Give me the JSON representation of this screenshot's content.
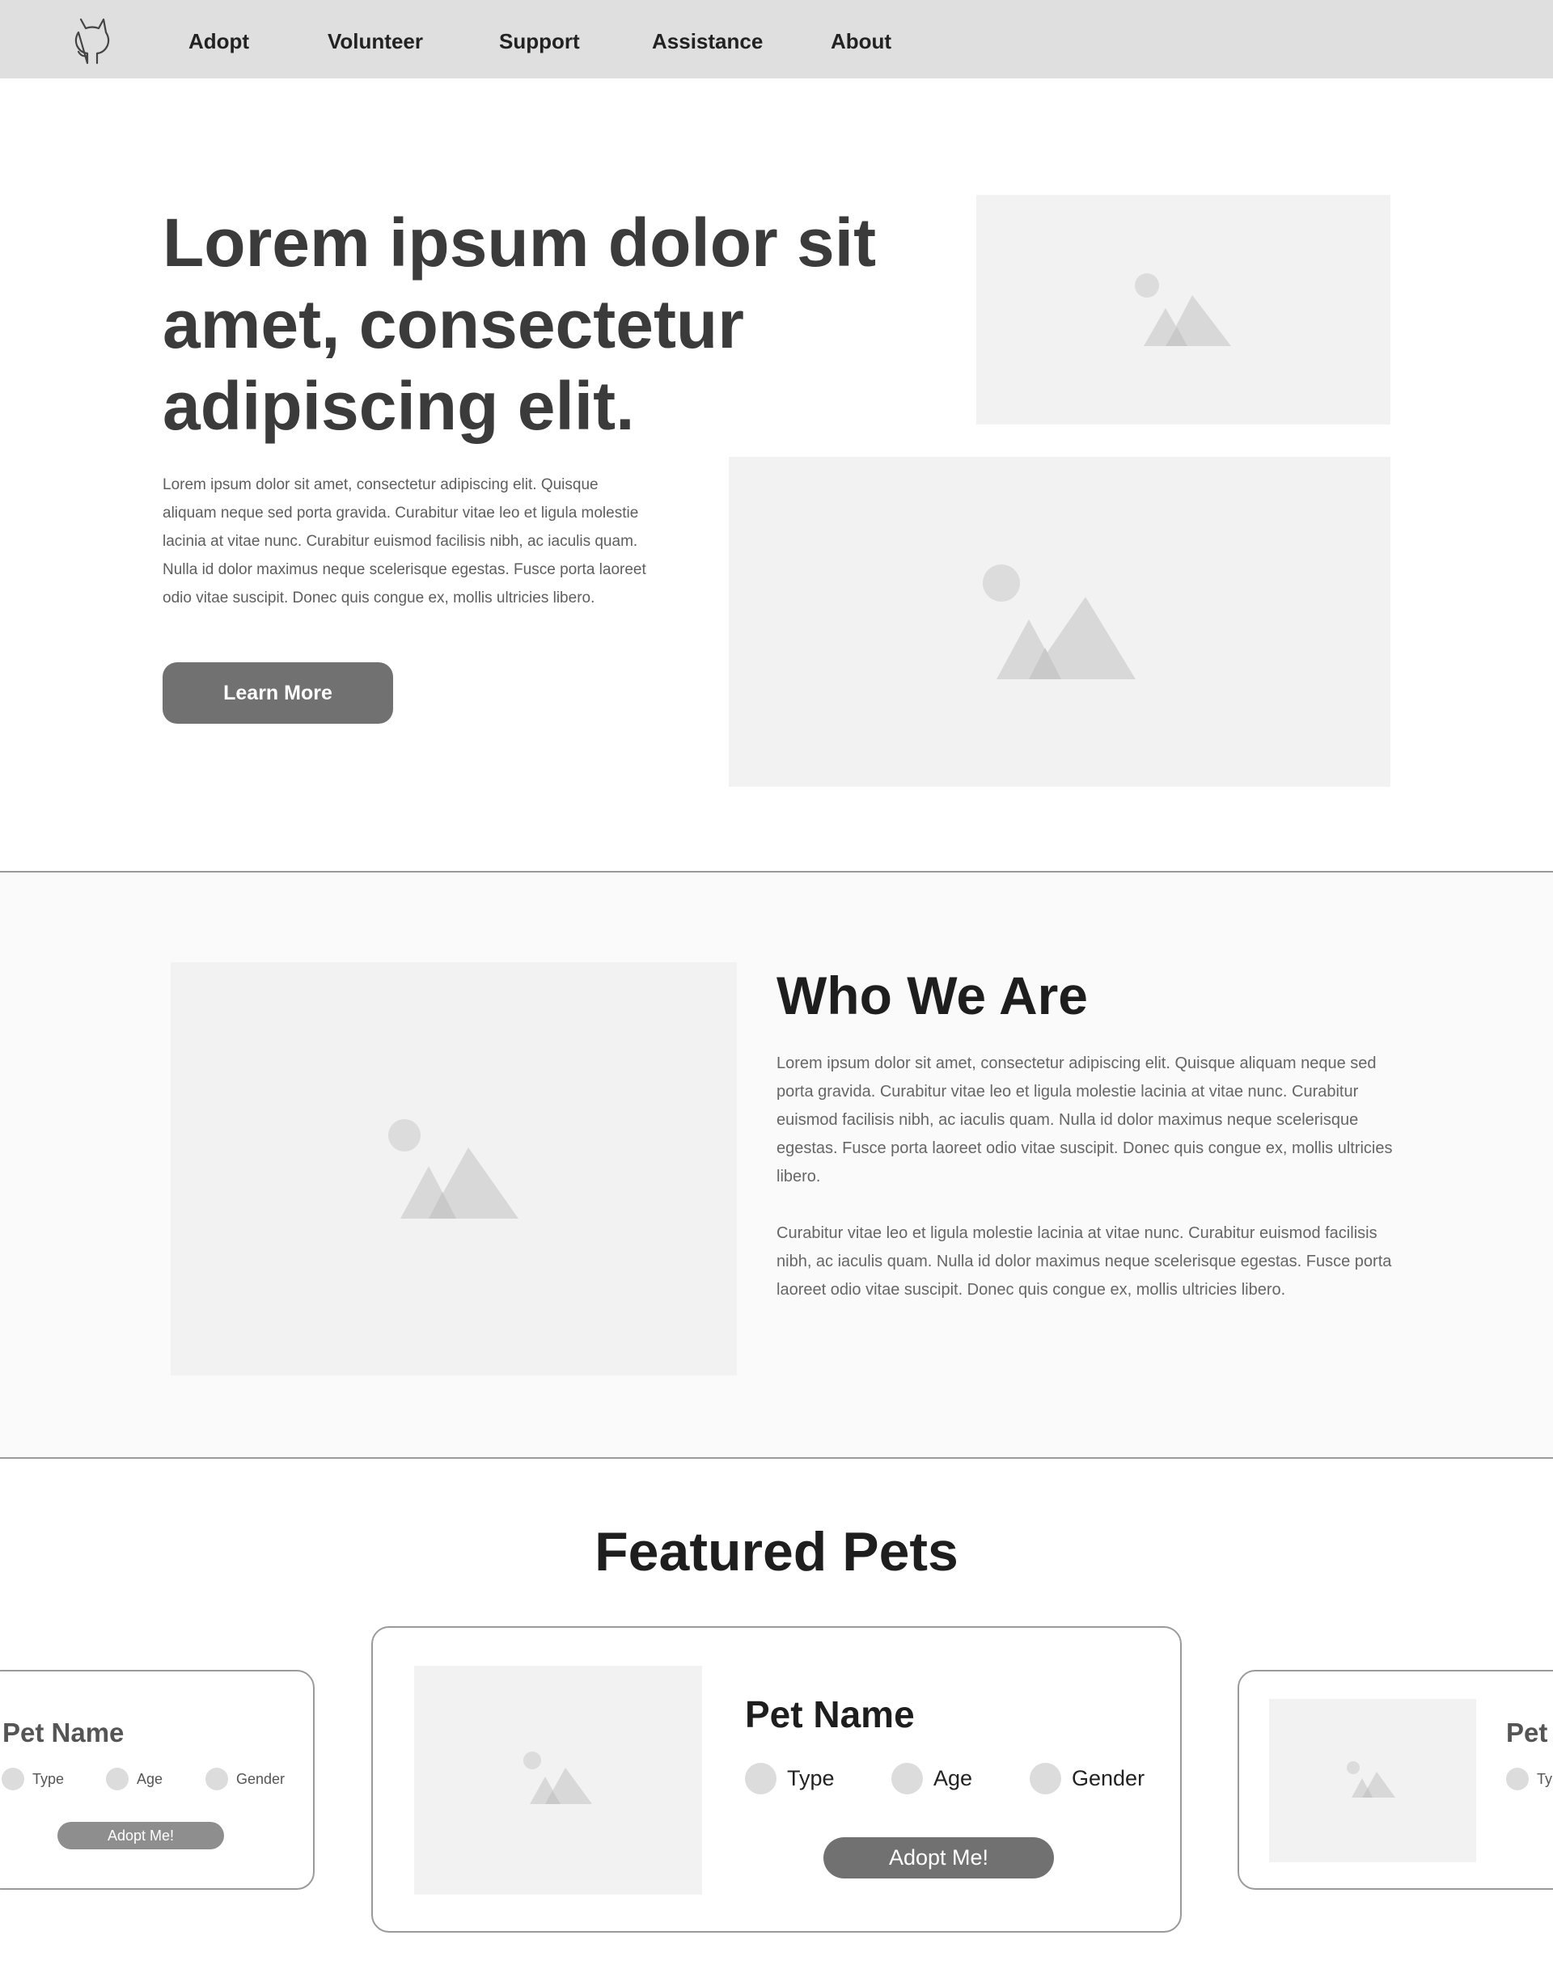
{
  "nav": {
    "logo_icon": "github-octocat-outline-icon",
    "items": [
      "Adopt",
      "Volunteer",
      "Support",
      "Assistance",
      "About"
    ]
  },
  "hero": {
    "title": "Lorem ipsum dolor sit amet, consectetur adipiscing elit.",
    "body": "Lorem ipsum dolor sit amet, consectetur adipiscing elit. Quisque aliquam neque sed porta gravida. Curabitur vitae leo et ligula molestie lacinia at vitae nunc. Curabitur euismod facilisis nibh, ac iaculis quam. Nulla id dolor maximus neque scelerisque egestas. Fusce porta laoreet odio vitae suscipit. Donec quis congue ex, mollis ultricies libero.",
    "button": "Learn More"
  },
  "who": {
    "title": "Who We Are",
    "paragraphs": [
      "Lorem ipsum dolor sit amet, consectetur adipiscing elit. Quisque aliquam neque sed porta gravida. Curabitur vitae leo et ligula molestie lacinia at vitae nunc. Curabitur euismod facilisis nibh, ac iaculis quam. Nulla id dolor maximus neque scelerisque egestas. Fusce porta laoreet odio vitae suscipit. Donec quis congue ex, mollis ultricies libero.",
      "Curabitur vitae leo et ligula molestie lacinia at vitae nunc. Curabitur euismod facilisis nibh, ac iaculis quam. Nulla id dolor maximus neque scelerisque egestas. Fusce porta laoreet odio vitae suscipit. Donec quis congue ex, mollis ultricies libero."
    ]
  },
  "featured": {
    "title": "Featured Pets",
    "cards": [
      {
        "name": "Pet Name",
        "options": [
          "Type",
          "Age",
          "Gender"
        ],
        "button": "Adopt Me!"
      },
      {
        "name": "Pet Name",
        "options": [
          "Type",
          "Age",
          "Gender"
        ],
        "button": "Adopt Me!"
      },
      {
        "name": "Pet",
        "options": [
          "Ty"
        ]
      }
    ]
  },
  "image_placeholder_icon": "image-placeholder-icon",
  "colors": {
    "nav_bg": "#dfdfdf",
    "button_bg": "#717171",
    "placeholder_bg": "#f2f2f2",
    "section_bg": "#fafafa"
  }
}
